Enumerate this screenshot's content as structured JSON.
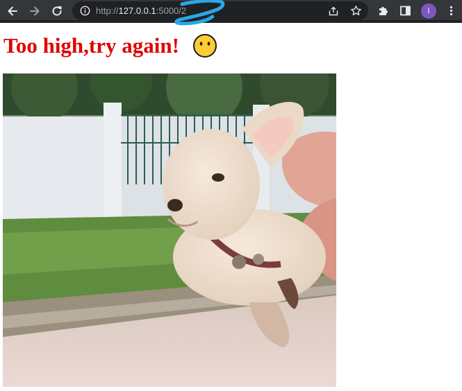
{
  "browser": {
    "url_scheme": "http://",
    "url_host": "127.0.0.1",
    "url_rest": ":5000/2",
    "profile_initial": "I",
    "icons": [
      "back-arrow-icon",
      "forward-arrow-icon",
      "reload-icon",
      "site-info-icon",
      "share-icon",
      "bookmark-star-icon",
      "extensions-puzzle-icon",
      "side-panel-icon",
      "menu-kebab-icon"
    ]
  },
  "page": {
    "heading": "Too high,try again!",
    "emoji": "neutral-face-icon",
    "image": "puppy-photo"
  },
  "colors": {
    "heading": "#e00000",
    "chrome_bg": "#35363a",
    "omnibox_bg": "#202124",
    "profile": "#7e57c2",
    "emoji_fill": "#ffcc33"
  }
}
